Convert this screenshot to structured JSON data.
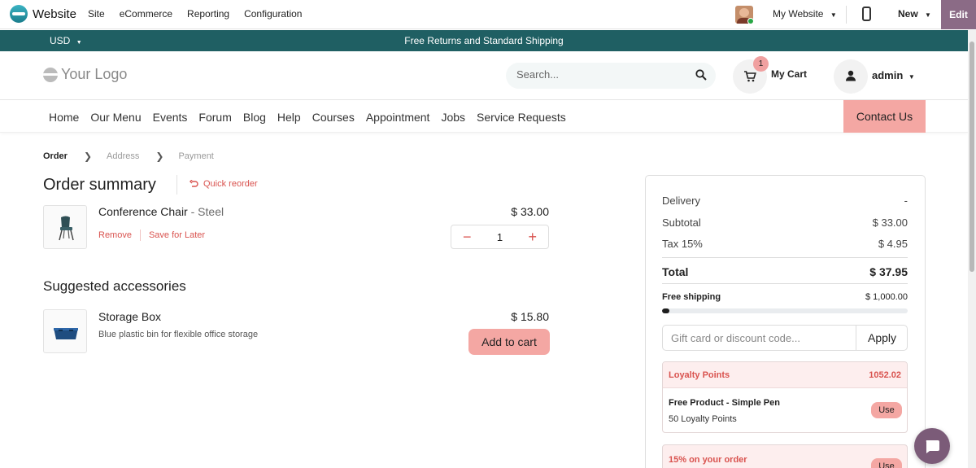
{
  "adminbar": {
    "app_name": "Website",
    "menu": [
      "Site",
      "eCommerce",
      "Reporting",
      "Configuration"
    ],
    "website_selector": "My Website",
    "new_label": "New",
    "edit_label": "Edit"
  },
  "promobar": {
    "currency": "USD",
    "message": "Free Returns and Standard Shipping"
  },
  "header": {
    "logo_text": "Your Logo",
    "search_placeholder": "Search...",
    "cart_count": "1",
    "cart_label": "My Cart",
    "user_label": "admin"
  },
  "nav": {
    "links": [
      "Home",
      "Our Menu",
      "Events",
      "Forum",
      "Blog",
      "Help",
      "Courses",
      "Appointment",
      "Jobs",
      "Service Requests"
    ],
    "contact_label": "Contact Us"
  },
  "breadcrumb": [
    "Order",
    "Address",
    "Payment"
  ],
  "order": {
    "title": "Order summary",
    "quick_reorder": "Quick reorder",
    "item": {
      "name": "Conference Chair",
      "variant": " - Steel",
      "price": "$ 33.00",
      "quantity": "1",
      "remove_label": "Remove",
      "save_label": "Save for Later"
    }
  },
  "suggested": {
    "title": "Suggested accessories",
    "item": {
      "name": "Storage Box",
      "description": "Blue plastic bin for flexible office storage",
      "price": "$ 15.80",
      "add_label": "Add to cart"
    }
  },
  "summary": {
    "delivery_label": "Delivery",
    "delivery_value": "-",
    "subtotal_label": "Subtotal",
    "subtotal_value": "$ 33.00",
    "tax_label": "Tax 15%",
    "tax_value": "$ 4.95",
    "total_label": "Total",
    "total_value": "$ 37.95",
    "free_shipping_label": "Free shipping",
    "free_shipping_threshold": "$ 1,000.00",
    "free_shipping_progress": 0.03,
    "coupon_placeholder": "Gift card or discount code...",
    "apply_label": "Apply",
    "loyalty": {
      "title": "Loyalty Points",
      "points": "1052.02",
      "reward_name": "Free Product - Simple Pen",
      "reward_cost": "50 Loyalty Points",
      "use_label": "Use"
    },
    "loyalty2": {
      "title": "15% on your order",
      "use_label": "Use"
    }
  }
}
